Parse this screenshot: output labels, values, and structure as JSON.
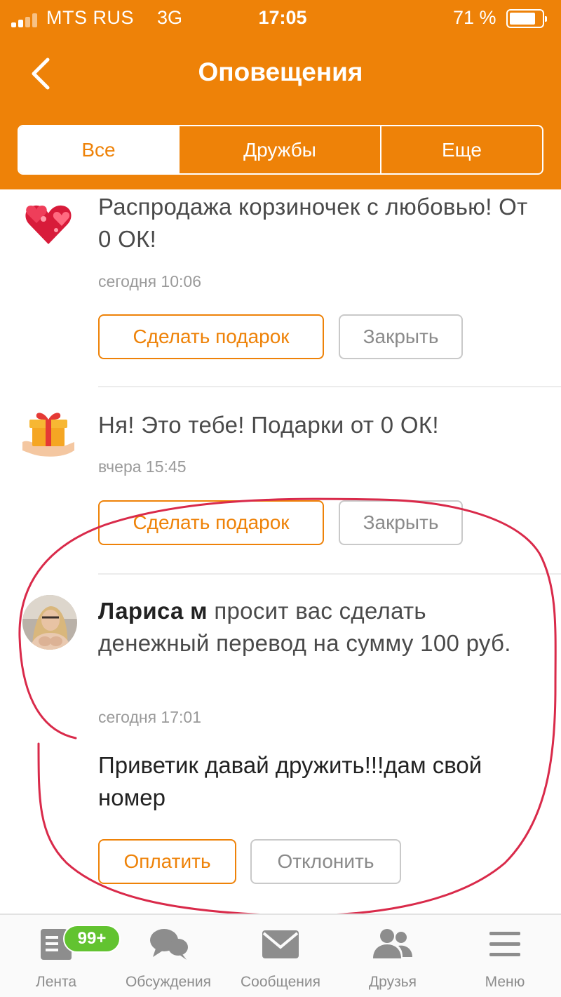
{
  "status_bar": {
    "carrier": "MTS RUS",
    "network": "3G",
    "time": "17:05",
    "battery": "71 %",
    "battery_level": 0.71
  },
  "header": {
    "title": "Оповещения",
    "back_icon": "chevron-left-icon"
  },
  "tabs": [
    {
      "label": "Все",
      "active": true
    },
    {
      "label": "Дружбы",
      "active": false
    },
    {
      "label": "Еще",
      "active": false
    }
  ],
  "notifications": [
    {
      "icon": "hearts-icon",
      "text": "Распродажа корзиночек с любовью! От 0 ОК!",
      "time": "сегодня 10:06",
      "primary_button": "Сделать подарок",
      "secondary_button": "Закрыть"
    },
    {
      "icon": "gift-in-hand-icon",
      "text": "Ня! Это тебе! Подарки от 0 ОК!",
      "time": "вчера 15:45",
      "primary_button": "Сделать подарок",
      "secondary_button": "Закрыть"
    },
    {
      "icon": "user-avatar",
      "sender": "Лариса м",
      "text": " просит вас сделать денежный перевод на сумму 100 руб.",
      "time": "сегодня 17:01",
      "message": "Приветик давай дружить!!!дам свой номер",
      "primary_button": "Оплатить",
      "secondary_button": "Отклонить"
    }
  ],
  "bottom_nav": [
    {
      "label": "Лента",
      "icon": "feed-icon",
      "badge": "99+"
    },
    {
      "label": "Обсуждения",
      "icon": "discussions-icon"
    },
    {
      "label": "Сообщения",
      "icon": "envelope-icon"
    },
    {
      "label": "Друзья",
      "icon": "friends-icon"
    },
    {
      "label": "Меню",
      "icon": "menu-icon"
    }
  ],
  "colors": {
    "brand": "#ee8208",
    "badge": "#62c330",
    "annotation": "#d92a4a"
  }
}
